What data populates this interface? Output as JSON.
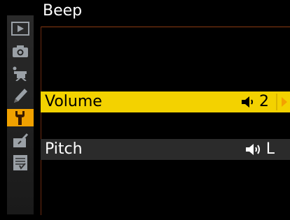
{
  "header": {
    "title": "Beep"
  },
  "menu_tabs": [
    {
      "name": "playback-menu-icon"
    },
    {
      "name": "shooting-menu-icon"
    },
    {
      "name": "movie-menu-icon"
    },
    {
      "name": "custom-settings-icon"
    },
    {
      "name": "setup-menu-icon",
      "active": true
    },
    {
      "name": "retouch-menu-icon"
    },
    {
      "name": "my-menu-icon"
    }
  ],
  "rows": {
    "volume": {
      "label": "Volume",
      "value": "2",
      "icon": "speaker-icon"
    },
    "pitch": {
      "label": "Pitch",
      "value": "L",
      "icon": "speaker-icon"
    }
  },
  "colors": {
    "highlight": "#f3d200",
    "accent": "#f0a100",
    "rule": "#8b3a12"
  }
}
